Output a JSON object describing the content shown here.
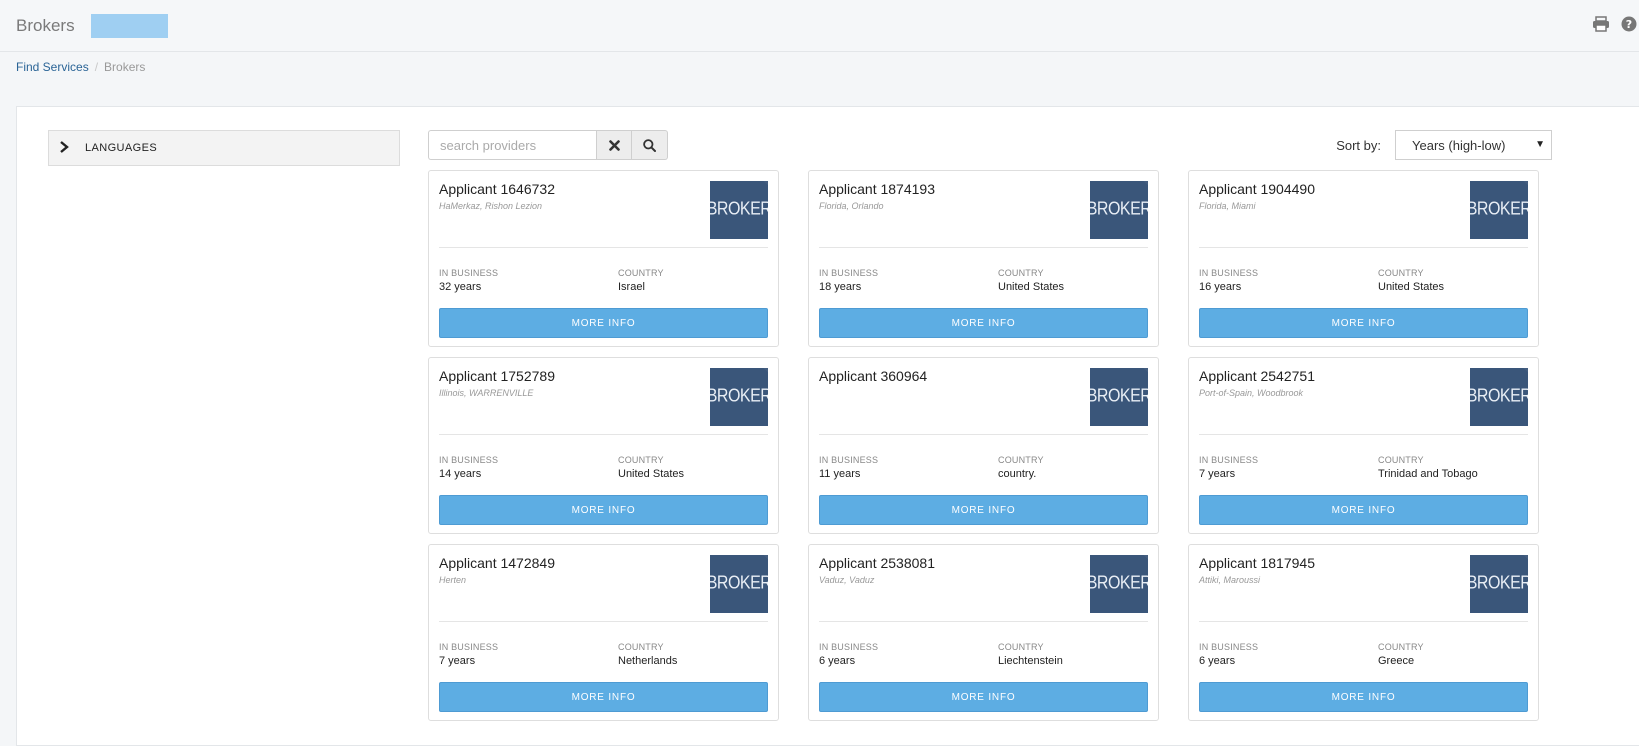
{
  "header": {
    "title": "Brokers",
    "print_icon": "print-icon",
    "help_icon": "help-icon"
  },
  "breadcrumb": {
    "parent": "Find Services",
    "separator": "/",
    "current": "Brokers"
  },
  "filters": {
    "languages_label": "LANGUAGES"
  },
  "search": {
    "placeholder": "search providers",
    "clear_icon": "clear-icon",
    "search_icon": "search-icon"
  },
  "sort": {
    "label": "Sort by:",
    "selected": "Years (high-low)"
  },
  "labels": {
    "in_business": "IN BUSINESS",
    "country": "COUNTRY",
    "more_info": "MORE INFO",
    "logo": "BROKER"
  },
  "cards": [
    {
      "name": "Applicant 1646732",
      "location": "HaMerkaz, Rishon Lezion",
      "years": "32 years",
      "country": "Israel"
    },
    {
      "name": "Applicant 1874193",
      "location": "Florida, Orlando",
      "years": "18 years",
      "country": "United States"
    },
    {
      "name": "Applicant 1904490",
      "location": "Florida, Miami",
      "years": "16 years",
      "country": "United States"
    },
    {
      "name": "Applicant 1752789",
      "location": "Illinois, WARRENVILLE",
      "years": "14 years",
      "country": "United States"
    },
    {
      "name": "Applicant 360964",
      "location": "",
      "years": "11 years",
      "country": "country."
    },
    {
      "name": "Applicant 2542751",
      "location": "Port-of-Spain, Woodbrook",
      "years": "7 years",
      "country": "Trinidad and Tobago"
    },
    {
      "name": "Applicant 1472849",
      "location": "Herten",
      "years": "7 years",
      "country": "Netherlands"
    },
    {
      "name": "Applicant 2538081",
      "location": "Vaduz, Vaduz",
      "years": "6 years",
      "country": "Liechtenstein"
    },
    {
      "name": "Applicant 1817945",
      "location": "Attiki, Maroussi",
      "years": "6 years",
      "country": "Greece"
    }
  ]
}
